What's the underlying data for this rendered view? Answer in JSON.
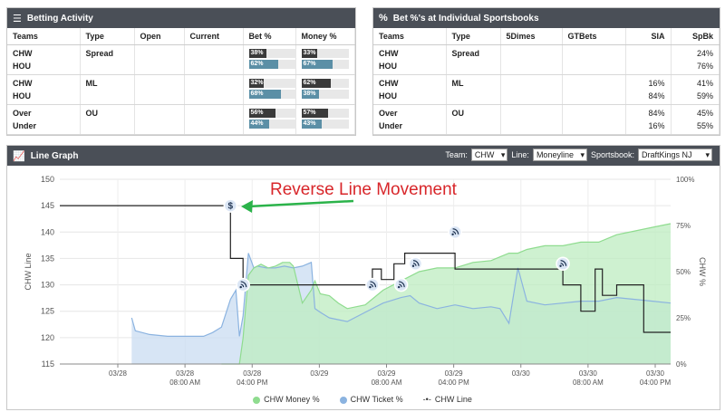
{
  "betting": {
    "title": "Betting Activity",
    "headers": [
      "Teams",
      "Type",
      "Open",
      "Current",
      "Bet %",
      "Money %"
    ],
    "rows": [
      {
        "teams": [
          "CHW",
          "HOU"
        ],
        "type": "Spread",
        "bet": [
          "38%",
          "62%"
        ],
        "money": [
          "33%",
          "67%"
        ]
      },
      {
        "teams": [
          "CHW",
          "HOU"
        ],
        "type": "ML",
        "bet": [
          "32%",
          "68%"
        ],
        "money": [
          "62%",
          "38%"
        ]
      },
      {
        "teams": [
          "Over",
          "Under"
        ],
        "type": "OU",
        "bet": [
          "56%",
          "44%"
        ],
        "money": [
          "57%",
          "43%"
        ]
      }
    ]
  },
  "sportsbooks": {
    "title": "Bet %'s at Individual Sportsbooks",
    "headers": [
      "Teams",
      "Type",
      "5Dimes",
      "GTBets",
      "SIA",
      "SpBk"
    ],
    "rows": [
      {
        "teams": [
          "CHW",
          "HOU"
        ],
        "type": "Spread",
        "dimes": [
          "",
          ""
        ],
        "gtbets": [
          "",
          ""
        ],
        "sia": [
          "",
          ""
        ],
        "spbk": [
          "24%",
          "76%"
        ]
      },
      {
        "teams": [
          "CHW",
          "HOU"
        ],
        "type": "ML",
        "dimes": [
          "",
          ""
        ],
        "gtbets": [
          "",
          ""
        ],
        "sia": [
          "16%",
          "84%"
        ],
        "spbk": [
          "41%",
          "59%"
        ]
      },
      {
        "teams": [
          "Over",
          "Under"
        ],
        "type": "OU",
        "dimes": [
          "",
          ""
        ],
        "gtbets": [
          "",
          ""
        ],
        "sia": [
          "84%",
          "16%"
        ],
        "spbk": [
          "45%",
          "55%"
        ]
      }
    ]
  },
  "linegraph": {
    "title": "Line Graph",
    "team_label": "Team:",
    "team_value": "CHW",
    "line_label": "Line:",
    "line_value": "Moneyline",
    "sportsbook_label": "Sportsbook:",
    "sportsbook_value": "DraftKings NJ",
    "annotation": "Reverse Line Movement"
  },
  "chart_data": {
    "type": "line",
    "ylabel_left": "CHW Line",
    "ylabel_right": "CHW %",
    "yticks_left": [
      "150",
      "145",
      "140",
      "135",
      "130",
      "125",
      "120",
      "115"
    ],
    "yticks_right": [
      "100%",
      "75%",
      "50%",
      "25%",
      "0%"
    ],
    "xticks": [
      {
        "l1": "03/28",
        "l2": ""
      },
      {
        "l1": "03/28",
        "l2": "08:00 AM"
      },
      {
        "l1": "03/28",
        "l2": "04:00 PM"
      },
      {
        "l1": "03/29",
        "l2": ""
      },
      {
        "l1": "03/29",
        "l2": "08:00 AM"
      },
      {
        "l1": "03/29",
        "l2": "04:00 PM"
      },
      {
        "l1": "03/30",
        "l2": ""
      },
      {
        "l1": "03/30",
        "l2": "08:00 AM"
      },
      {
        "l1": "03/30",
        "l2": "04:00 PM"
      }
    ],
    "ylim_left": [
      115,
      150
    ],
    "ylim_right": [
      0,
      100
    ],
    "colors": {
      "money": "#8fdc8f",
      "ticket": "#8bb3e0",
      "line": "#222222"
    },
    "series": [
      {
        "name": "CHW Money %",
        "x": [
          0.5,
          0.6,
          0.62,
          0.65,
          0.68,
          0.72,
          0.76,
          0.8,
          0.84,
          0.88,
          0.9,
          0.95,
          1.0,
          1.02,
          1.05,
          1.1,
          1.15,
          1.2,
          1.3,
          1.4,
          1.5,
          1.6,
          1.7,
          1.8,
          1.9,
          2.0,
          2.05,
          2.1,
          2.15,
          2.2,
          2.3,
          2.4,
          2.5,
          2.6,
          2.7,
          2.8,
          2.9,
          3.0
        ],
        "values": [
          0,
          0,
          14,
          48,
          52,
          54,
          52,
          53,
          55,
          55,
          53,
          33,
          40,
          45,
          38,
          37,
          33,
          30,
          32,
          40,
          45,
          50,
          52,
          52,
          55,
          56,
          58,
          60,
          60,
          62,
          64,
          64,
          66,
          66,
          70,
          72,
          74,
          76
        ]
      },
      {
        "name": "CHW Ticket %",
        "x": [
          0,
          0.02,
          0.1,
          0.2,
          0.3,
          0.4,
          0.45,
          0.5,
          0.55,
          0.58,
          0.6,
          0.62,
          0.65,
          0.68,
          0.7,
          0.75,
          0.8,
          0.85,
          0.9,
          0.95,
          1.0,
          1.02,
          1.05,
          1.1,
          1.2,
          1.3,
          1.4,
          1.5,
          1.55,
          1.6,
          1.7,
          1.8,
          1.9,
          2.0,
          2.05,
          2.1,
          2.15,
          2.2,
          2.3,
          2.4,
          2.5,
          2.6,
          2.7,
          2.8,
          2.9,
          3.0
        ],
        "values": [
          25,
          18,
          16,
          15,
          15,
          15,
          17,
          20,
          35,
          40,
          15,
          26,
          60,
          52,
          53,
          52,
          52,
          53,
          52,
          53,
          55,
          30,
          28,
          25,
          23,
          28,
          33,
          36,
          37,
          33,
          30,
          32,
          30,
          31,
          30,
          22,
          52,
          34,
          32,
          33,
          34,
          34,
          36,
          35,
          34,
          33
        ]
      },
      {
        "name": "CHW Line",
        "x": [
          -0.4,
          0.55,
          0.55,
          0.62,
          0.62,
          1.34,
          1.34,
          1.39,
          1.39,
          1.46,
          1.46,
          1.52,
          1.52,
          1.8,
          1.8,
          2.4,
          2.4,
          2.5,
          2.5,
          2.58,
          2.58,
          2.62,
          2.62,
          2.7,
          2.7,
          2.85,
          2.85,
          3.0
        ],
        "values": [
          145,
          145,
          135,
          135,
          130,
          130,
          133,
          133,
          131,
          131,
          134,
          134,
          136,
          136,
          133,
          133,
          130,
          130,
          125,
          125,
          133,
          133,
          128,
          128,
          130,
          130,
          121,
          121
        ]
      }
    ],
    "markers": [
      {
        "x": 0.55,
        "y": 145,
        "kind": "$"
      },
      {
        "x": 0.62,
        "y": 130,
        "kind": "wifi"
      },
      {
        "x": 1.34,
        "y": 130,
        "kind": "wifi"
      },
      {
        "x": 1.5,
        "y": 130,
        "kind": "wifi"
      },
      {
        "x": 1.58,
        "y": 134,
        "kind": "wifi"
      },
      {
        "x": 1.8,
        "y": 140,
        "kind": "wifi"
      },
      {
        "x": 2.4,
        "y": 134,
        "kind": "wifi"
      }
    ],
    "legend": [
      "CHW Money %",
      "CHW Ticket %",
      "CHW Line"
    ]
  }
}
